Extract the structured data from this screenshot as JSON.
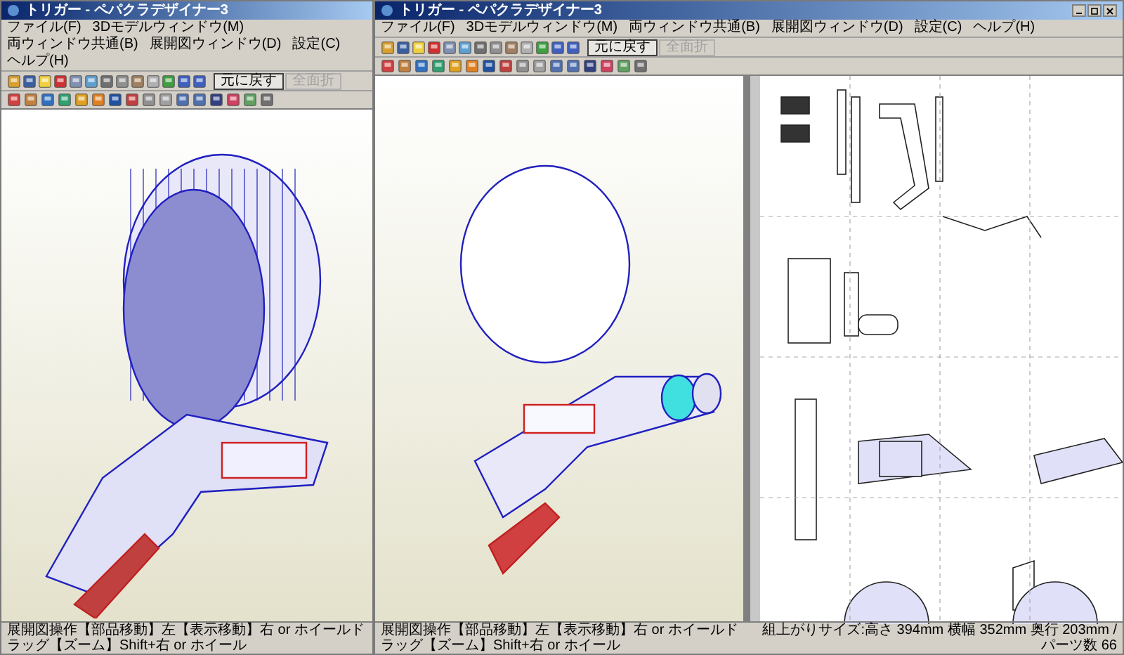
{
  "windows": [
    {
      "title": "トリガー - ペパクラデザイナー3",
      "menu": [
        "ファイル(F)",
        "3Dモデルウィンドウ(M)",
        "両ウィンドウ共通(B)",
        "展開図ウィンドウ(D)",
        "設定(C)",
        "ヘルプ(H)"
      ],
      "undo_button": "元に戻す",
      "fold_button": {
        "label": "全面折",
        "disabled": true
      },
      "status_left": "展開図操作【部品移動】左【表示移動】右 or ホイールドラッグ【ズーム】Shift+右 or ホイール",
      "has_pattern_view": false,
      "window_controls": false
    },
    {
      "title": "トリガー - ペパクラデザイナー3",
      "menu": [
        "ファイル(F)",
        "3Dモデルウィンドウ(M)",
        "両ウィンドウ共通(B)",
        "展開図ウィンドウ(D)",
        "設定(C)",
        "ヘルプ(H)"
      ],
      "undo_button": "元に戻す",
      "fold_button": {
        "label": "全面折",
        "disabled": true
      },
      "status_left": "展開図操作【部品移動】左【表示移動】右 or ホイールドラッグ【ズーム】Shift+右 or ホイール",
      "status_right": "組上がりサイズ:高さ 394mm 横幅 352mm 奥行 203mm / パーツ数 66",
      "has_pattern_view": true,
      "window_controls": true
    }
  ]
}
